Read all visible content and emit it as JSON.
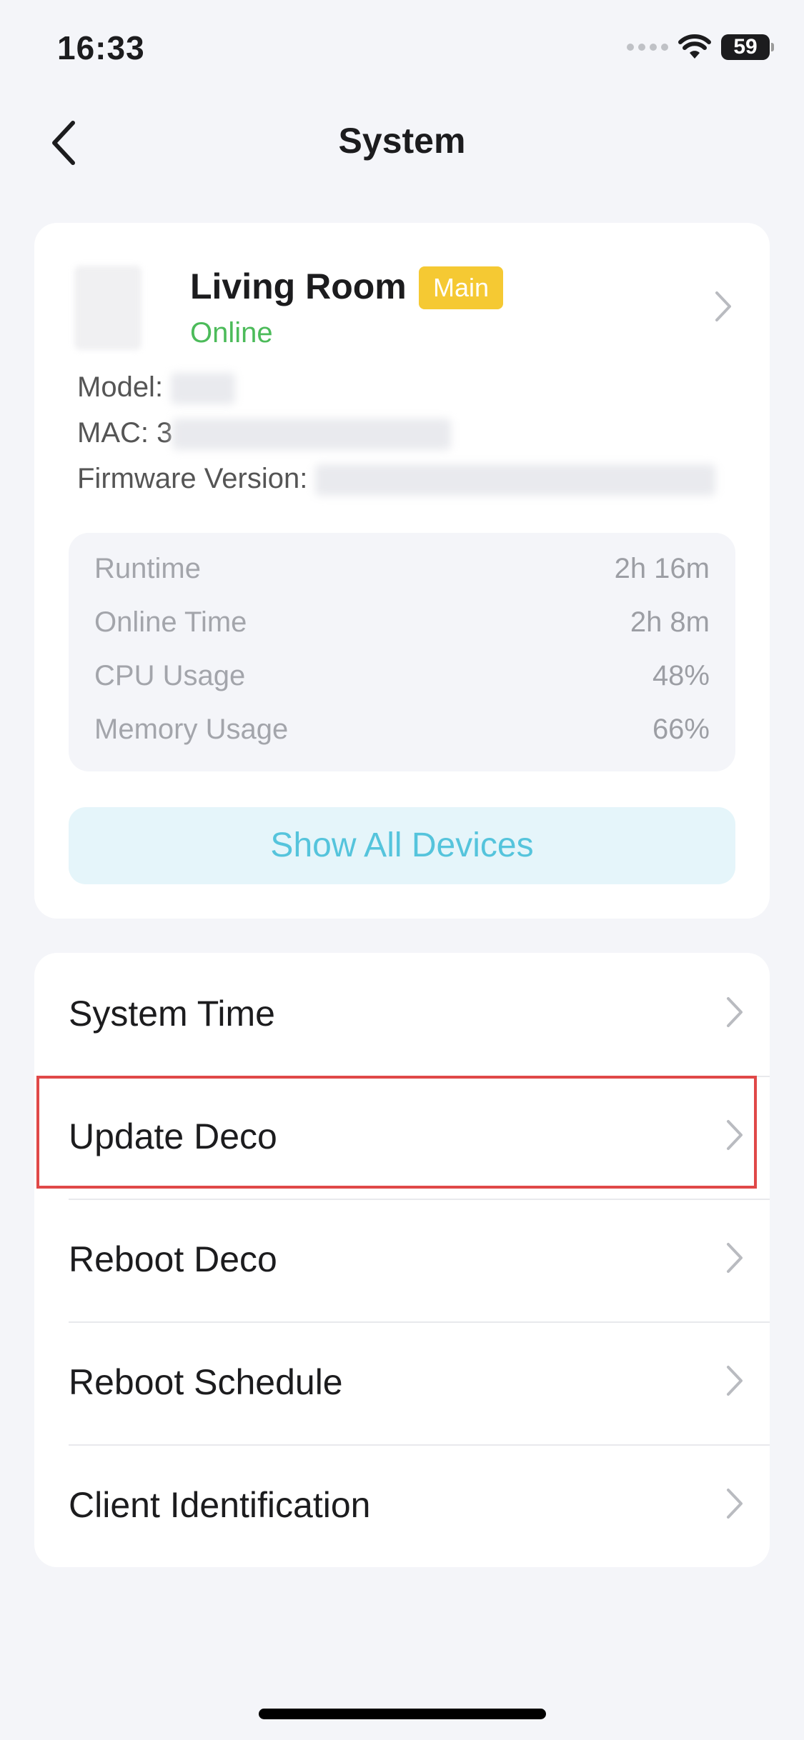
{
  "status_bar": {
    "time": "16:33",
    "battery": "59"
  },
  "nav": {
    "title": "System"
  },
  "device": {
    "name": "Living Room",
    "badge": "Main",
    "status": "Online",
    "model_label": "Model:",
    "mac_label": "MAC: 3",
    "firmware_label": "Firmware Version:"
  },
  "stats": [
    {
      "label": "Runtime",
      "value": "2h 16m"
    },
    {
      "label": "Online Time",
      "value": "2h 8m"
    },
    {
      "label": "CPU Usage",
      "value": "48%"
    },
    {
      "label": "Memory Usage",
      "value": "66%"
    }
  ],
  "show_all_label": "Show All Devices",
  "menu": [
    {
      "label": "System Time"
    },
    {
      "label": "Update Deco"
    },
    {
      "label": "Reboot Deco"
    },
    {
      "label": "Reboot Schedule"
    },
    {
      "label": "Client Identification"
    }
  ],
  "colors": {
    "online": "#4cbb5a",
    "badge": "#f5c933",
    "accent": "#55c4dc",
    "highlight": "#e04848"
  },
  "icons": [
    "back-chevron-icon",
    "chevron-right-icon",
    "wifi-icon",
    "battery-icon",
    "signal-icon"
  ]
}
